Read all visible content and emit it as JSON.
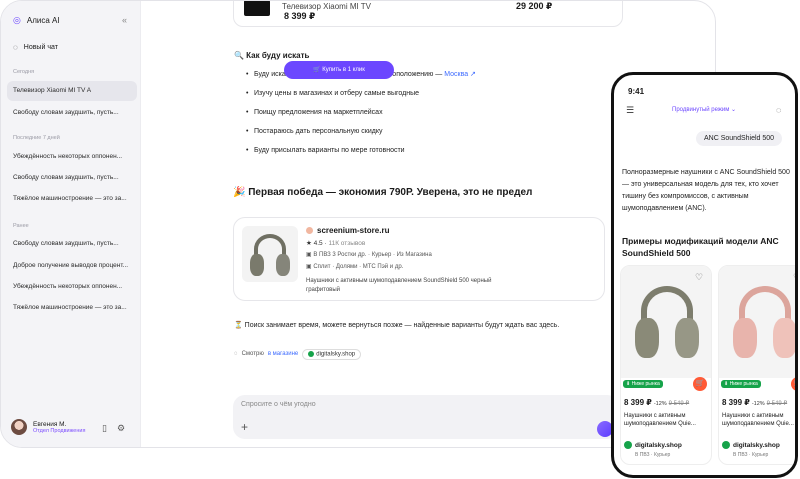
{
  "sidebar": {
    "app_name": "Алиса AI",
    "new_chat": "Новый чат",
    "sections": [
      {
        "title": "Сегодня",
        "items": [
          "Телевизор Xiaomi MI TV A",
          "Свободу словам заудшить, пусть..."
        ]
      },
      {
        "title": "Последние 7 дней",
        "items": [
          "Убеждённость некоторых оппонен...",
          "Свободу словам заудшить, пусть...",
          "Тяжёлое машиностроение — это за..."
        ]
      },
      {
        "title": "Ранее",
        "items": [
          "Свободу словам заудшить, пусть...",
          "Доброе получение выводов процент...",
          "Убеждённость некоторых оппонен...",
          "Тяжёлое машиностроение — это за..."
        ]
      }
    ],
    "user": {
      "name": "Евгения М.",
      "subscription": "Отдел Продвижения"
    }
  },
  "chat": {
    "top_card": {
      "title": "Телевизор Xiaomi MI TV",
      "price": "29 200 ₽"
    },
    "how_title": "🔍 Как буду искать",
    "steps": [
      {
        "text": "Буду искать предложения по вашему местоположению — ",
        "link": "Москва ↗"
      },
      {
        "text": "Изучу цены в магазинах и отберу самые выгодные"
      },
      {
        "text": "Поищу предложения на маркетплейсах"
      },
      {
        "text": "Постараюсь дать персональную скидку"
      },
      {
        "text": "Буду присылать варианты по мере готовности"
      }
    ],
    "win_title": "🎉 Первая победа — экономия 790Р. Уверена, это не предел",
    "product": {
      "shop": "screenium-store.ru",
      "rating": "4.5",
      "reviews": "11К отзывов",
      "pickup": "В ПВЗ 3 Ростки др. · Курьер · Из Магазина",
      "delivery": "Сплит · Долями · МТС Пэй и др.",
      "description": "Наушники с активным шумоподавлением SoundShield 500 черный графитовый",
      "price": "8 399 ₽",
      "buy_label": "Купить в 1 клик"
    },
    "note": "⏳ Поиск занимает время, можете вернуться позже — найденные варианты будут ждать вас здесь.",
    "watch_prefix": "Смотрю",
    "watch_link": "в магазине",
    "watch_chip": "digitalsky.shop",
    "composer_placeholder": "Спросите о чём угодно"
  },
  "phone": {
    "time": "9:41",
    "mode": "Продвинутый режим",
    "query": "ANC SoundShield 500",
    "answer": "Полноразмерные наушники с ANC SoundShield 500 — это универсальная модель для тех, кто хочет тишину без компромиссов, с активным шумоподавлением (ANC).",
    "heading": "Примеры модификаций модели ANC SoundShield 500",
    "cards": [
      {
        "badge": "Ниже рынка",
        "price": "8 399 ₽",
        "discount": "-12%",
        "old_price": "9 549 ₽",
        "name": "Наушники с активным шумоподавлением Quie...",
        "shop": "digitalsky.shop",
        "pickup": "В ПВЗ · Курьер",
        "color": "#8a8a78"
      },
      {
        "badge": "Ниже рынка",
        "price": "8 399 ₽",
        "discount": "-12%",
        "old_price": "9 549 ₽",
        "name": "Наушники с активным шумоподавлением Quie...",
        "shop": "digitalsky.shop",
        "pickup": "В ПВЗ · Курьер",
        "color": "#e8b4ac"
      }
    ]
  },
  "colors": {
    "accent": "#6c47ff",
    "green": "#16a34a",
    "cart": "#ff5a36"
  }
}
